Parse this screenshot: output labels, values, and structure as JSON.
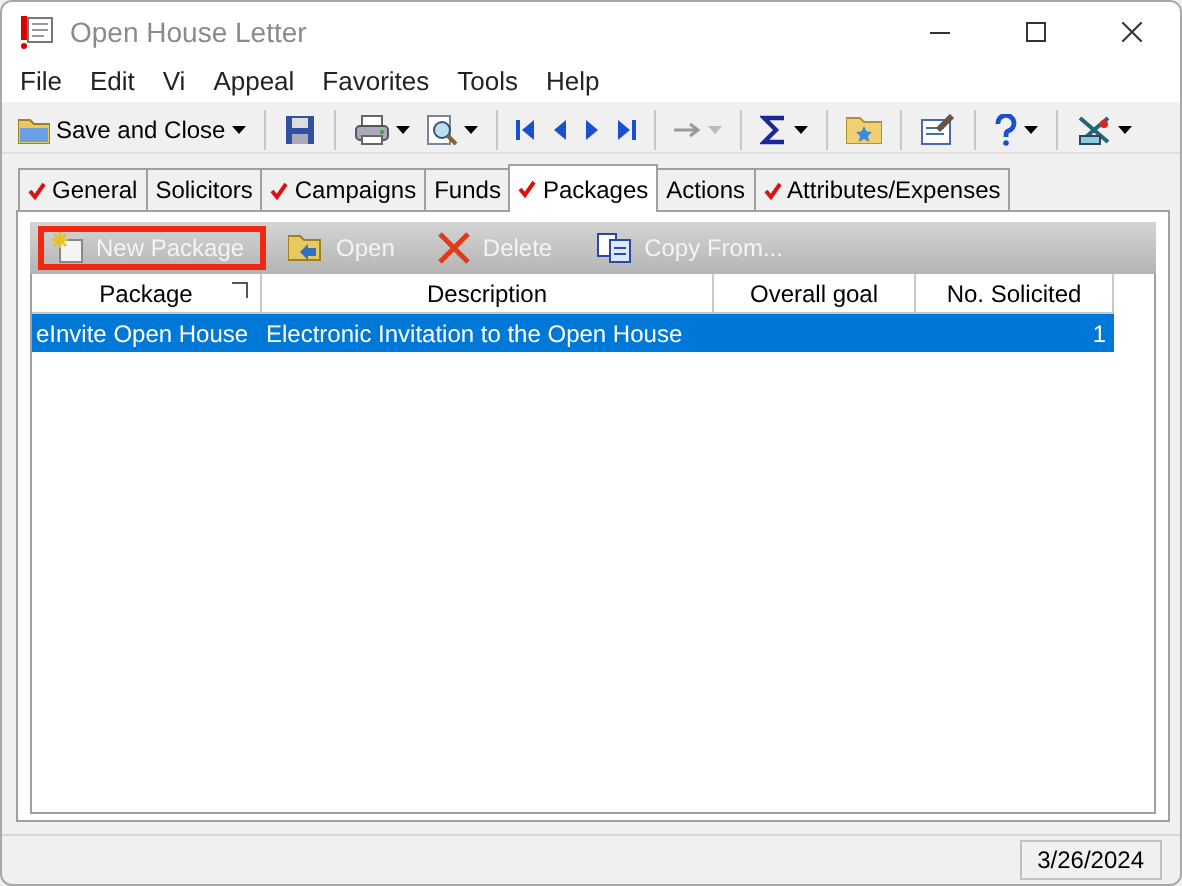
{
  "window": {
    "title": "Open House Letter"
  },
  "menu": [
    "File",
    "Edit",
    "Vi",
    "Appeal",
    "Favorites",
    "Tools",
    "Help"
  ],
  "toolbar": {
    "save_label": "Save and Close",
    "go_to_disabled": true
  },
  "tabs": [
    {
      "label": "General",
      "checked": true,
      "selected": false
    },
    {
      "label": "Solicitors",
      "checked": false,
      "selected": false
    },
    {
      "label": "Campaigns",
      "checked": true,
      "selected": false
    },
    {
      "label": "Funds",
      "checked": false,
      "selected": false
    },
    {
      "label": "Packages",
      "checked": true,
      "selected": true
    },
    {
      "label": "Actions",
      "checked": false,
      "selected": false
    },
    {
      "label": "Attributes/Expenses",
      "checked": true,
      "selected": false
    }
  ],
  "actions": [
    {
      "kind": "new",
      "label": "New Package",
      "disabled": true,
      "highlighted": true
    },
    {
      "kind": "open",
      "label": "Open",
      "disabled": true,
      "highlighted": false
    },
    {
      "kind": "delete",
      "label": "Delete",
      "disabled": true,
      "highlighted": false
    },
    {
      "kind": "copy",
      "label": "Copy From...",
      "disabled": true,
      "highlighted": false
    }
  ],
  "table": {
    "columns": [
      "Package",
      "Description",
      "Overall goal",
      "No. Solicited"
    ],
    "rows": [
      {
        "package": "eInvite Open House",
        "description": "Electronic Invitation to the Open House",
        "no_solicited": "1",
        "selected": true
      }
    ]
  },
  "status_bar": {
    "date": "3/26/2024"
  }
}
